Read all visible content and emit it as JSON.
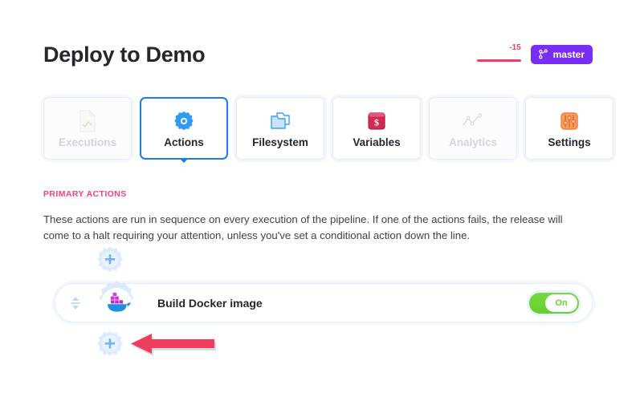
{
  "header": {
    "title": "Deploy to Demo",
    "revision": {
      "value": "-15",
      "icon": "revision-meter-icon",
      "color": "#ef3e62"
    },
    "branch": {
      "label": "master",
      "icon": "git-branch-icon",
      "color": "#7a2ef5"
    }
  },
  "tabs": [
    {
      "label": "Executions",
      "icon": "executions-document-icon",
      "state": "disabled"
    },
    {
      "label": "Actions",
      "icon": "gear-icon",
      "state": "active"
    },
    {
      "label": "Filesystem",
      "icon": "folder-stack-icon",
      "state": "normal"
    },
    {
      "label": "Variables",
      "icon": "dollar-variable-icon",
      "state": "normal"
    },
    {
      "label": "Analytics",
      "icon": "line-chart-icon",
      "state": "disabled"
    },
    {
      "label": "Settings",
      "icon": "sliders-icon",
      "state": "normal"
    }
  ],
  "section": {
    "label": "PRIMARY ACTIONS",
    "label_color": "#f8417e",
    "description": "These actions are run in sequence on every execution of the pipeline. If one of the actions fails, the release will come to a halt requiring your attention, unless you've set a conditional action down the line."
  },
  "pipeline": {
    "add_action_top": {
      "icon": "plus-gear-icon",
      "label": ""
    },
    "add_action_bottom": {
      "icon": "plus-gear-icon",
      "label": ""
    },
    "action": {
      "name": "Build Docker image",
      "icon": "docker-whale-icon",
      "drag_handle_icon": "sort-updown-icon",
      "toggle": {
        "label": "On",
        "state": "on",
        "color": "#6ace36"
      }
    }
  },
  "annotation": {
    "arrow": {
      "icon": "left-arrow-annotation",
      "color": "#ef3e5e",
      "points_to": "add-action-bottom-button"
    }
  }
}
